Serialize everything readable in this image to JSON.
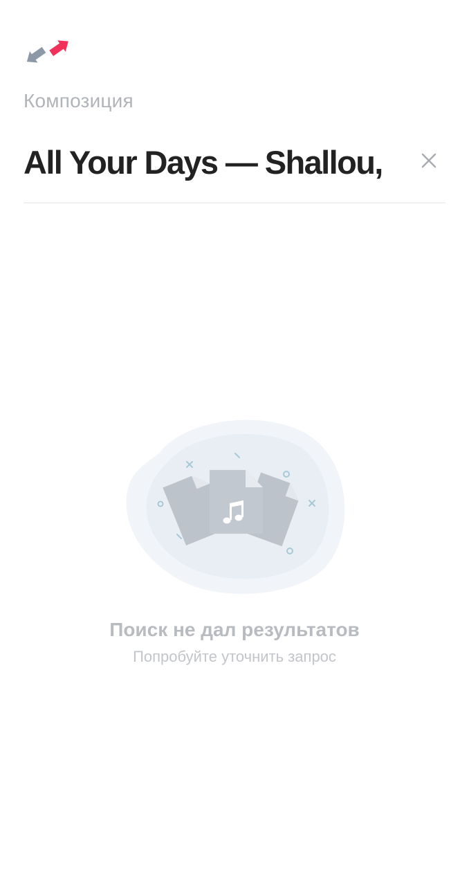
{
  "app": {
    "logo_icon": "transfer-arrows-logo",
    "colors": {
      "logo_gray": "#8d99a6",
      "logo_red": "#f2315a",
      "label_gray": "#b1b4b8",
      "text_dark": "#222222",
      "divider": "#eef0f2",
      "illustration_bg": "#eef2f7",
      "file_gray": "#c2c8cf",
      "accent_blue": "#a8c9d6"
    }
  },
  "search": {
    "label": "Композиция",
    "value": "All Your Days — Shallou,",
    "clear_icon": "close-icon"
  },
  "empty_state": {
    "illustration_icon": "music-files-icon",
    "title": "Поиск не дал результатов",
    "subtitle": "Попробуйте уточнить запрос"
  }
}
